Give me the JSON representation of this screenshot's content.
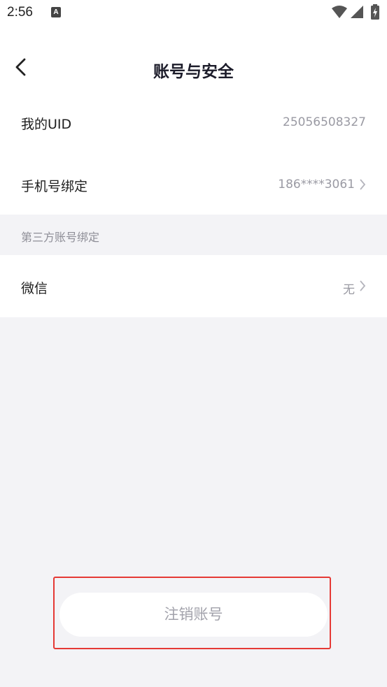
{
  "status_bar": {
    "time": "2:56",
    "app_icon_letter": "A"
  },
  "header": {
    "title": "账号与安全"
  },
  "uid_row": {
    "label": "我的UID",
    "value": "25056508327"
  },
  "phone_row": {
    "label": "手机号绑定",
    "value": "186****3061"
  },
  "third_party_section": {
    "header": "第三方账号绑定",
    "wechat": {
      "label": "微信",
      "value": "无"
    }
  },
  "footer": {
    "cancel_account_label": "注销账号"
  },
  "colors": {
    "background": "#f3f3f6",
    "card": "#ffffff",
    "secondary_text": "#9a9aa3",
    "highlight": "#e53935"
  }
}
